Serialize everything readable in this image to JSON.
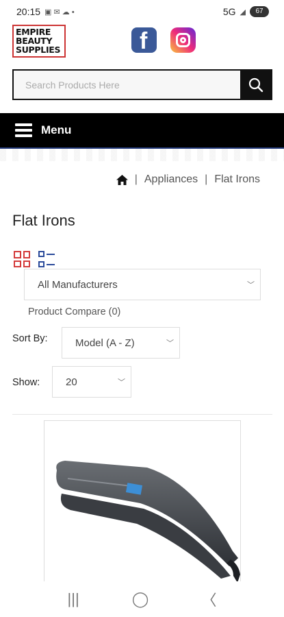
{
  "status": {
    "time": "20:15",
    "network": "5G",
    "battery": "67"
  },
  "brand": {
    "logo_lines": [
      "EMPIRE",
      "BEAUTY",
      "SUPPLIES"
    ]
  },
  "search": {
    "placeholder": "Search Products Here"
  },
  "menu": {
    "label": "Menu"
  },
  "breadcrumb": {
    "items": [
      "Appliances",
      "Flat Irons"
    ]
  },
  "page_title": "Flat Irons",
  "filters": {
    "manufacturer": "All Manufacturers",
    "product_compare": "Product Compare (0)",
    "sort_label": "Sort By:",
    "sort_value": "Model (A - Z)",
    "show_label": "Show:",
    "show_value": "20"
  },
  "colors": {
    "accent": "#d43a3a",
    "menu_bg": "#000000",
    "facebook": "#3b5998"
  },
  "icons": [
    "home-icon",
    "grid-view-icon",
    "list-view-icon",
    "search-icon",
    "menu-icon",
    "facebook-icon",
    "instagram-icon"
  ]
}
